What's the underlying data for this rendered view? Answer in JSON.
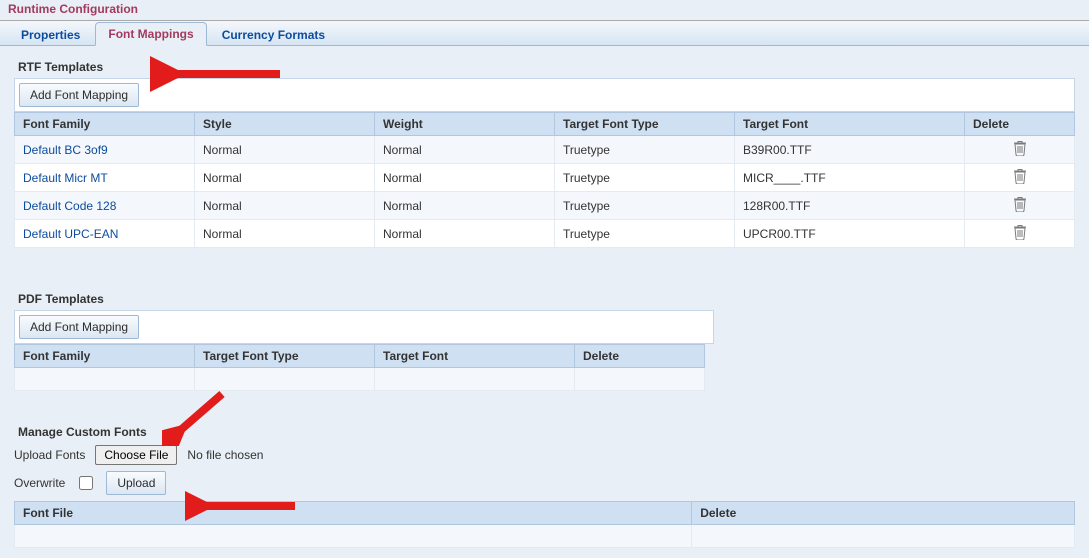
{
  "page_title": "Runtime Configuration",
  "tabs": {
    "properties": "Properties",
    "font_mappings": "Font Mappings",
    "currency_formats": "Currency Formats"
  },
  "rtf": {
    "title": "RTF Templates",
    "add_btn": "Add Font Mapping",
    "headers": {
      "font_family": "Font Family",
      "style": "Style",
      "weight": "Weight",
      "target_font_type": "Target Font Type",
      "target_font": "Target Font",
      "delete": "Delete"
    },
    "rows": [
      {
        "font_family": "Default BC 3of9",
        "style": "Normal",
        "weight": "Normal",
        "target_font_type": "Truetype",
        "target_font": "B39R00.TTF"
      },
      {
        "font_family": "Default Micr MT",
        "style": "Normal",
        "weight": "Normal",
        "target_font_type": "Truetype",
        "target_font": "MICR____.TTF"
      },
      {
        "font_family": "Default Code 128",
        "style": "Normal",
        "weight": "Normal",
        "target_font_type": "Truetype",
        "target_font": "128R00.TTF"
      },
      {
        "font_family": "Default UPC-EAN",
        "style": "Normal",
        "weight": "Normal",
        "target_font_type": "Truetype",
        "target_font": "UPCR00.TTF"
      }
    ]
  },
  "pdf": {
    "title": "PDF Templates",
    "add_btn": "Add Font Mapping",
    "headers": {
      "font_family": "Font Family",
      "target_font_type": "Target Font Type",
      "target_font": "Target Font",
      "delete": "Delete"
    }
  },
  "custom_fonts": {
    "title": "Manage Custom Fonts",
    "upload_fonts_label": "Upload Fonts",
    "choose_file_btn": "Choose File",
    "no_file_text": "No file chosen",
    "overwrite_label": "Overwrite",
    "upload_btn": "Upload",
    "headers": {
      "font_file": "Font File",
      "delete": "Delete"
    }
  }
}
